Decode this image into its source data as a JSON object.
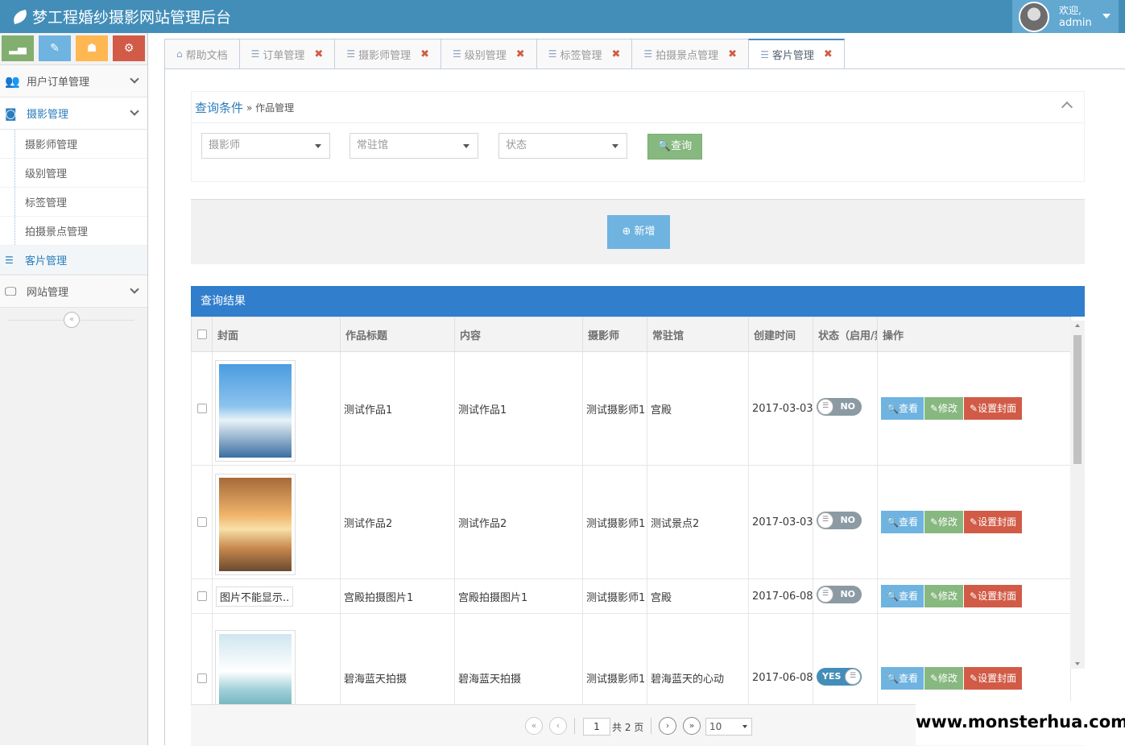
{
  "app": {
    "title": "梦工程婚纱摄影网站管理后台"
  },
  "user": {
    "welcome": "欢迎,",
    "name": "admin"
  },
  "colors": {
    "header": "#438eb9",
    "accent": "#2b7dbc",
    "success": "#87b87f",
    "info": "#6fb3e0",
    "danger": "#d15b47",
    "warning": "#ffb752"
  },
  "shortcuts": [
    {
      "icon": "signal-icon",
      "color": "success"
    },
    {
      "icon": "pencil-icon",
      "color": "info"
    },
    {
      "icon": "users-icon",
      "color": "warning"
    },
    {
      "icon": "cogs-icon",
      "color": "danger"
    }
  ],
  "sidebar": {
    "order_menu": "用户订单管理",
    "photo_menu": "摄影管理",
    "photo_items": [
      "摄影师管理",
      "级别管理",
      "标签管理",
      "拍摄景点管理",
      "客片管理"
    ],
    "site_menu": "网站管理"
  },
  "tabs": [
    {
      "label": "帮助文档",
      "icon": "home-icon",
      "closable": false
    },
    {
      "label": "订单管理",
      "icon": "sliders-icon",
      "closable": true
    },
    {
      "label": "摄影师管理",
      "icon": "sliders-icon",
      "closable": true
    },
    {
      "label": "级别管理",
      "icon": "sliders-icon",
      "closable": true
    },
    {
      "label": "标签管理",
      "icon": "sliders-icon",
      "closable": true
    },
    {
      "label": "拍摄景点管理",
      "icon": "sliders-icon",
      "closable": true
    },
    {
      "label": "客片管理",
      "icon": "sliders-icon",
      "closable": true,
      "active": true
    }
  ],
  "query": {
    "title": "查询条件",
    "breadcrumb": "» 作品管理",
    "photographer_placeholder": "摄影师",
    "venue_placeholder": "常驻馆",
    "status_placeholder": "状态",
    "search_label": "查询"
  },
  "actions": {
    "add_label": "新增"
  },
  "results": {
    "title": "查询结果",
    "columns": [
      "封面",
      "作品标题",
      "内容",
      "摄影师",
      "常驻馆",
      "创建时间",
      "状态（启用/禁用）",
      "操作"
    ],
    "rows": [
      {
        "cover": "img1",
        "title": "测试作品1",
        "content": "测试作品1",
        "photographer": "测试摄影师1",
        "venue": "宫殿",
        "created": "2017-03-03",
        "status": "NO"
      },
      {
        "cover": "img2",
        "title": "测试作品2",
        "content": "测试作品2",
        "photographer": "测试摄影师1",
        "venue": "测试景点2",
        "created": "2017-03-03",
        "status": "NO"
      },
      {
        "cover_alt": "图片不能显示..",
        "title": "宫殿拍摄图片1",
        "content": "宫殿拍摄图片1",
        "photographer": "测试摄影师1",
        "venue": "宫殿",
        "created": "2017-06-08",
        "status": "NO"
      },
      {
        "cover": "img4",
        "title": "碧海蓝天拍摄",
        "content": "碧海蓝天拍摄",
        "photographer": "测试摄影师1",
        "venue": "碧海蓝天的心动",
        "created": "2017-06-08",
        "status": "YES"
      }
    ],
    "btn_view": "查看",
    "btn_edit": "修改",
    "btn_cover": "设置封面"
  },
  "pager": {
    "page": "1",
    "total": "共 2 页",
    "size": "10"
  },
  "watermark": "www.monsterhua.com"
}
